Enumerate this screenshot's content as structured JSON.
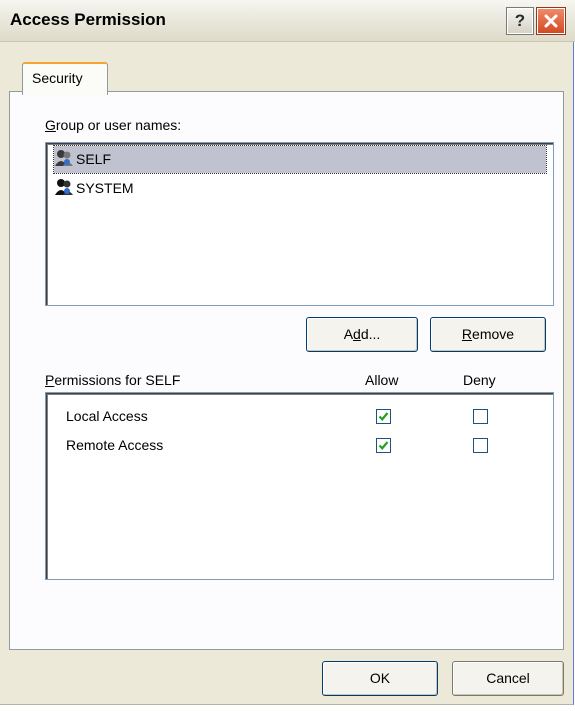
{
  "window": {
    "title": "Access Permission"
  },
  "title_buttons": {
    "help_glyph": "?"
  },
  "tabs": [
    {
      "label": "Security"
    }
  ],
  "group": {
    "label": "Group or user names:",
    "users": [
      {
        "name": "SELF",
        "icon": "user-group-icon",
        "selected": true
      },
      {
        "name": "SYSTEM",
        "icon": "user-group-icon",
        "selected": false
      }
    ]
  },
  "buttons": {
    "add": "Add...",
    "remove": "Remove",
    "ok": "OK",
    "cancel": "Cancel"
  },
  "permissions": {
    "label": "Permissions for SELF",
    "allow_header": "Allow",
    "deny_header": "Deny",
    "items": [
      {
        "name": "Local Access",
        "allow": true,
        "deny": false
      },
      {
        "name": "Remote Access",
        "allow": true,
        "deny": false
      }
    ]
  },
  "colors": {
    "accent": "#f6a431",
    "check": "#21a121",
    "close": "#d24a22"
  }
}
